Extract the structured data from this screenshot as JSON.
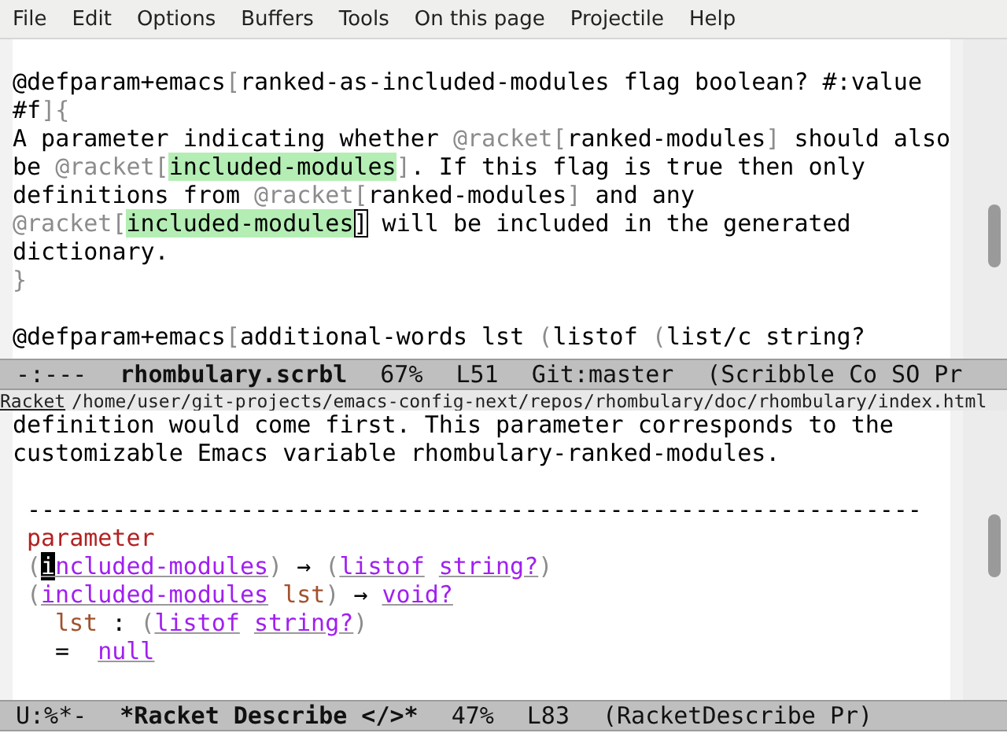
{
  "menu_bar": {
    "items": [
      "File",
      "Edit",
      "Options",
      "Buffers",
      "Tools",
      "On this page",
      "Projectile",
      "Help"
    ]
  },
  "top_window": {
    "lines": [
      {
        "segments": [
          {
            "kind": "plain",
            "text": "@defparam+emacs"
          },
          {
            "kind": "dim",
            "text": "["
          },
          {
            "kind": "plain",
            "text": "ranked-as-included-modules flag boolean? #:value"
          }
        ]
      },
      {
        "segments": [
          {
            "kind": "plain",
            "text": "#f"
          },
          {
            "kind": "dim",
            "text": "]{"
          }
        ]
      },
      {
        "segments": [
          {
            "kind": "plain",
            "text": "A parameter indicating whether "
          },
          {
            "kind": "dim",
            "text": "@racket["
          },
          {
            "kind": "plain",
            "text": "ranked-modules"
          },
          {
            "kind": "dim",
            "text": "]"
          },
          {
            "kind": "plain",
            "text": " should also"
          }
        ]
      },
      {
        "segments": [
          {
            "kind": "plain",
            "text": "be "
          },
          {
            "kind": "dim",
            "text": "@racket["
          },
          {
            "kind": "match",
            "text": "included-modules"
          },
          {
            "kind": "dim",
            "text": "]"
          },
          {
            "kind": "plain",
            "text": ". If this flag is true then only"
          }
        ]
      },
      {
        "segments": [
          {
            "kind": "plain",
            "text": "definitions from "
          },
          {
            "kind": "dim",
            "text": "@racket["
          },
          {
            "kind": "plain",
            "text": "ranked-modules"
          },
          {
            "kind": "dim",
            "text": "]"
          },
          {
            "kind": "plain",
            "text": " and any"
          }
        ]
      },
      {
        "segments": [
          {
            "kind": "dim",
            "text": "@racket["
          },
          {
            "kind": "match",
            "text": "included-modules"
          },
          {
            "kind": "box-cursor",
            "text": "]"
          },
          {
            "kind": "plain",
            "text": " will be included in the generated"
          }
        ]
      },
      {
        "segments": [
          {
            "kind": "plain",
            "text": "dictionary."
          }
        ]
      },
      {
        "segments": [
          {
            "kind": "dim",
            "text": "}"
          }
        ]
      },
      {
        "space_before": true,
        "segments": [
          {
            "kind": "plain",
            "text": "@defparam+emacs"
          },
          {
            "kind": "dim",
            "text": "["
          },
          {
            "kind": "plain",
            "text": "additional-words lst "
          },
          {
            "kind": "dim",
            "text": "("
          },
          {
            "kind": "plain",
            "text": "listof "
          },
          {
            "kind": "dim",
            "text": "("
          },
          {
            "kind": "plain",
            "text": "list/c string?"
          }
        ]
      }
    ]
  },
  "top_mode_line": {
    "segments": [
      {
        "text": "-:---",
        "bold": false
      },
      {
        "text": "rhombulary.scrbl",
        "bold": true
      },
      {
        "text": "67%",
        "bold": false
      },
      {
        "text": "L51",
        "bold": false
      },
      {
        "text": "Git:master",
        "bold": false
      },
      {
        "text": "(Scribble Co SO Pr",
        "bold": false
      }
    ]
  },
  "header_line": {
    "link": "Racket",
    "path": "/home/user/git-projects/emacs-config-next/repos/rhombulary/doc/rhombulary/index.html"
  },
  "bottom_window": {
    "lines": [
      {
        "segments": [
          {
            "kind": "plain",
            "text": "definition would come first. This parameter corresponds to the"
          }
        ]
      },
      {
        "segments": [
          {
            "kind": "plain",
            "text": "customizable Emacs variable rhombulary-ranked-modules."
          }
        ]
      },
      {
        "space_before": true,
        "indented": true,
        "segments": [
          {
            "kind": "plain",
            "text": "---------------------------------------------------------------"
          }
        ]
      },
      {
        "indented": true,
        "segments": [
          {
            "kind": "keyword",
            "text": "parameter"
          }
        ]
      },
      {
        "indented": true,
        "segments": [
          {
            "kind": "dim",
            "text": "("
          },
          {
            "kind": "block-cursor",
            "text": "i"
          },
          {
            "kind": "link",
            "text": "ncluded-modules"
          },
          {
            "kind": "dim",
            "text": ")"
          },
          {
            "kind": "plain",
            "text": " → "
          },
          {
            "kind": "dim",
            "text": "("
          },
          {
            "kind": "link",
            "text": "listof"
          },
          {
            "kind": "link",
            "text": "string?",
            "space_before": true
          },
          {
            "kind": "dim",
            "text": ")"
          }
        ]
      },
      {
        "indented": true,
        "segments": [
          {
            "kind": "dim",
            "text": "("
          },
          {
            "kind": "link",
            "text": "included-modules"
          },
          {
            "kind": "arg",
            "text": "lst",
            "space_before": true
          },
          {
            "kind": "dim",
            "text": ")"
          },
          {
            "kind": "plain",
            "text": " → "
          },
          {
            "kind": "link",
            "text": "void?"
          }
        ]
      },
      {
        "indented": true,
        "nested": true,
        "segments": [
          {
            "kind": "arg",
            "text": "lst"
          },
          {
            "kind": "plain",
            "text": " : "
          },
          {
            "kind": "dim",
            "text": "("
          },
          {
            "kind": "link",
            "text": "listof"
          },
          {
            "kind": "link",
            "text": "string?",
            "space_before": true
          },
          {
            "kind": "dim",
            "text": ")"
          }
        ]
      },
      {
        "indented": true,
        "nested": true,
        "segments": [
          {
            "kind": "plain",
            "text": "=  "
          },
          {
            "kind": "link",
            "text": "null"
          }
        ]
      }
    ]
  },
  "bottom_mode_line": {
    "segments": [
      {
        "text": "U:%*-",
        "bold": false
      },
      {
        "text": "*Racket Describe </>*",
        "bold": true
      },
      {
        "text": "47%",
        "bold": false
      },
      {
        "text": "L83",
        "bold": false
      },
      {
        "text": "(RacketDescribe Pr)",
        "bold": false
      }
    ]
  }
}
